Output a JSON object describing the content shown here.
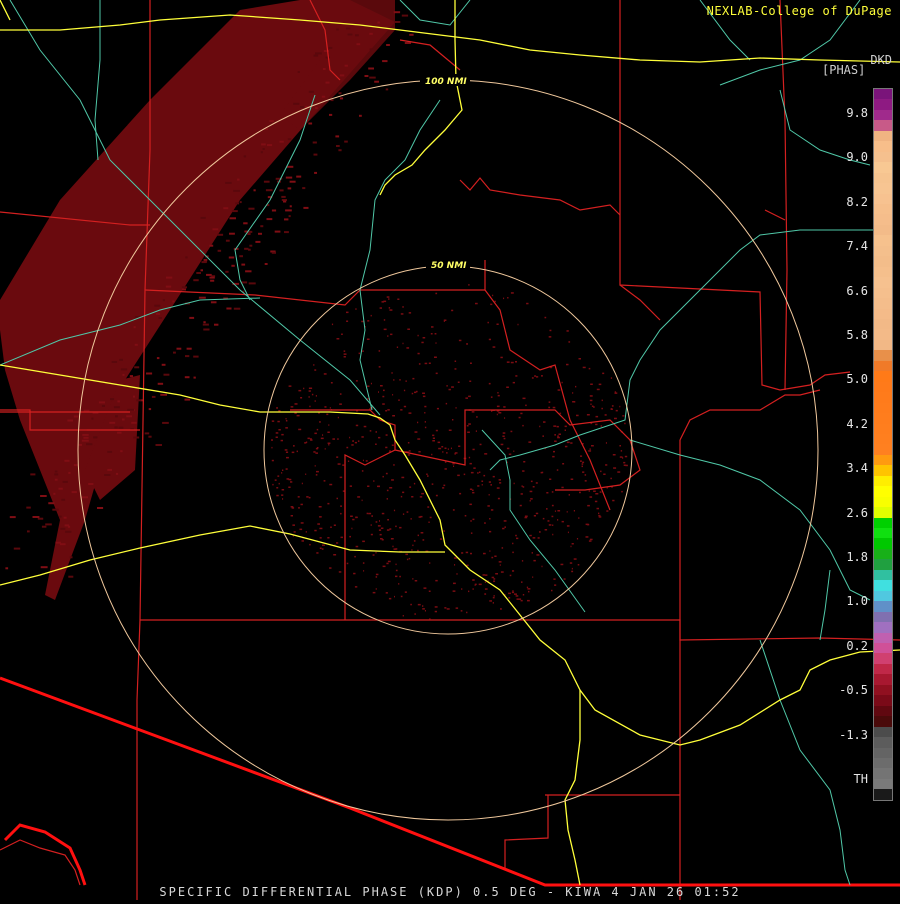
{
  "credit": "NEXLAB-College of DuPage",
  "product_code": "DKD",
  "unit": "[PHAS]",
  "footer": "SPECIFIC DIFFERENTIAL PHASE (KDP) 0.5 DEG - KIWA 4 JAN 26 01:52",
  "rings": [
    "50 NMI",
    "100 NMI"
  ],
  "legend": {
    "ticks": [
      "9.8",
      "9.0",
      "8.2",
      "7.4",
      "6.6",
      "5.8",
      "5.0",
      "4.2",
      "3.4",
      "2.6",
      "1.8",
      "1.0",
      "0.2",
      "-0.5",
      "-1.3",
      "TH"
    ],
    "colors": [
      "#7a147a",
      "#8e1a82",
      "#a02a8c",
      "#c85a88",
      "#f0b482",
      "#f7be8a",
      "#f5c08e",
      "#f8c893",
      "#f6c490",
      "#f7c592",
      "#f7c290",
      "#f6bf8c",
      "#f5bd8b",
      "#f3bb89",
      "#f6c18d",
      "#f4bf8c",
      "#f3bd8a",
      "#f5bf8c",
      "#f6c18f",
      "#f5bf8d",
      "#f4bd8b",
      "#f4bb89",
      "#f2b987",
      "#f3ba88",
      "#f2b886",
      "#e8904a",
      "#f07a28",
      "#ff7a18",
      "#ff7a1a",
      "#ff7b1b",
      "#ff7c1c",
      "#ff7d1d",
      "#ff7e1e",
      "#ff7f1f",
      "#ff8020",
      "#ff9a10",
      "#ffc400",
      "#ffee00",
      "#ffff00",
      "#f8ff00",
      "#e0ff00",
      "#00d000",
      "#10e010",
      "#00c800",
      "#18b018",
      "#20a040",
      "#30c0a0",
      "#40e0e0",
      "#50c8e0",
      "#6090c8",
      "#8070b0",
      "#a070c0",
      "#c060b0",
      "#d05098",
      "#d04070",
      "#c02848",
      "#a81830",
      "#901020",
      "#7a0a18",
      "#600810",
      "#4a0a0a",
      "#4c4c4c",
      "#5c5c5c",
      "#646464",
      "#6c6c6c",
      "#747474",
      "#7a7a7a",
      "#1a1a1a"
    ]
  },
  "colors": {
    "boundary": "#d42020",
    "highway": "#ffff3a",
    "road": "#50c8a8",
    "ring": "#f0c89c",
    "echo": "#6a0a0e",
    "border": "#ff1010"
  }
}
